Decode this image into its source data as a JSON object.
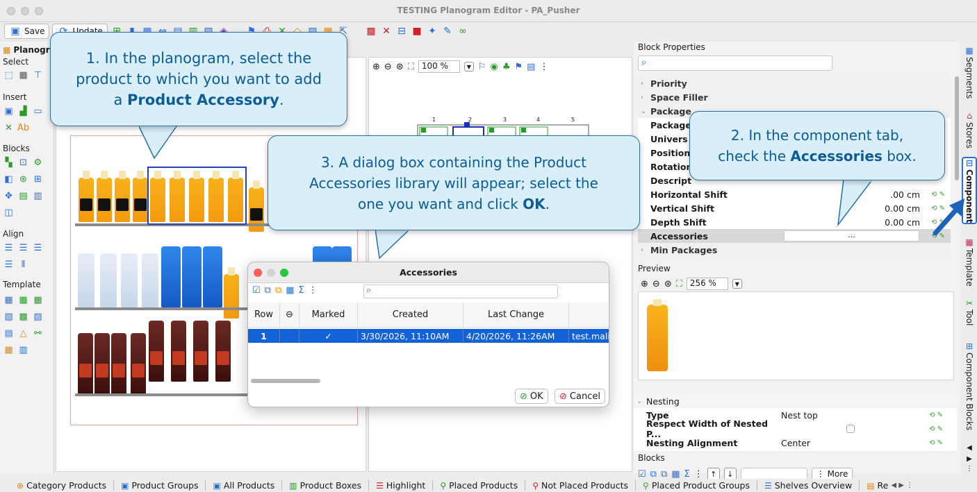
{
  "window": {
    "title": "TESTING Planogram Editor - PA_Pusher"
  },
  "toolbar": {
    "save": "Save",
    "update": "Update"
  },
  "left": {
    "planogram_tab": "Planogram",
    "select": "Select",
    "insert": "Insert",
    "blocks": "Blocks",
    "align": "Align",
    "template": "Template"
  },
  "canvas": {
    "zoom": "100 %",
    "shelf_numbers": [
      "1",
      "2",
      "3",
      "4",
      "5"
    ]
  },
  "properties": {
    "title": "Block Properties",
    "rows": [
      {
        "name": "Priority",
        "value": "",
        "group": true
      },
      {
        "name": "Space Filler",
        "value": "",
        "group": true
      },
      {
        "name": "Package",
        "value": "",
        "group": true
      },
      {
        "name": "Package",
        "value": ""
      },
      {
        "name": "Univers",
        "value": ""
      },
      {
        "name": "Position",
        "value": ""
      },
      {
        "name": "Rotation",
        "value": ""
      },
      {
        "name": "Descript",
        "value": ""
      },
      {
        "name": "Horizontal Shift",
        "value": "0.00 cm"
      },
      {
        "name": "Vertical Shift",
        "value": "0.00 cm"
      },
      {
        "name": "Depth Shift",
        "value": "0.00 cm"
      },
      {
        "name": "Accessories",
        "value": "..."
      },
      {
        "name": "Min Packages",
        "value": "",
        "group": true
      }
    ],
    "horizontal_shift_short": ".00 cm"
  },
  "preview": {
    "title": "Preview",
    "zoom": "256 %"
  },
  "nesting": {
    "title": "Nesting",
    "rows": [
      {
        "name": "Type",
        "value": "Nest top"
      },
      {
        "name": "Respect Width of Nested P...",
        "value": ""
      },
      {
        "name": "Nesting Alignment",
        "value": "Center"
      }
    ]
  },
  "blocks_section": {
    "title": "Blocks",
    "more": "More"
  },
  "right_tabs": [
    "Segments",
    "Stores",
    "Component",
    "Template",
    "Tool",
    "Component Blocks"
  ],
  "bottom_tabs": [
    "Category Products",
    "Product Groups",
    "All Products",
    "Product Boxes",
    "Highlight",
    "Placed Products",
    "Not Placed Products",
    "Placed Product Groups",
    "Shelves Overview",
    "Re"
  ],
  "dialog": {
    "title": "Accessories",
    "columns": [
      "Row",
      "Marked",
      "Created",
      "Last Change"
    ],
    "row": {
      "row": "1",
      "marked": "✓",
      "created": "3/30/2026, 11:10AM",
      "last_change": "4/20/2026, 11:26AM",
      "extra": "test.mali"
    },
    "ok": "OK",
    "cancel": "Cancel"
  },
  "callouts": {
    "c1_line1": "1. In the planogram, select the",
    "c1_line2": "product to which you want to add",
    "c1_line3a": "a ",
    "c1_line3b": "Product Accessory",
    "c1_line3c": ".",
    "c2_line1": "2. In the component tab,",
    "c2_line2a": "check the ",
    "c2_line2b": "Accessories",
    "c2_line2c": " box.",
    "c3_line1": "3. A dialog box containing the Product",
    "c3_line2": "Accessories library will appear; select the",
    "c3_line3a": "one you want and click ",
    "c3_line3b": "OK",
    "c3_line3c": "."
  },
  "colors": {
    "accent": "#1463d6",
    "callout_bg": "#d8eef9",
    "callout_text": "#0e5c94"
  }
}
